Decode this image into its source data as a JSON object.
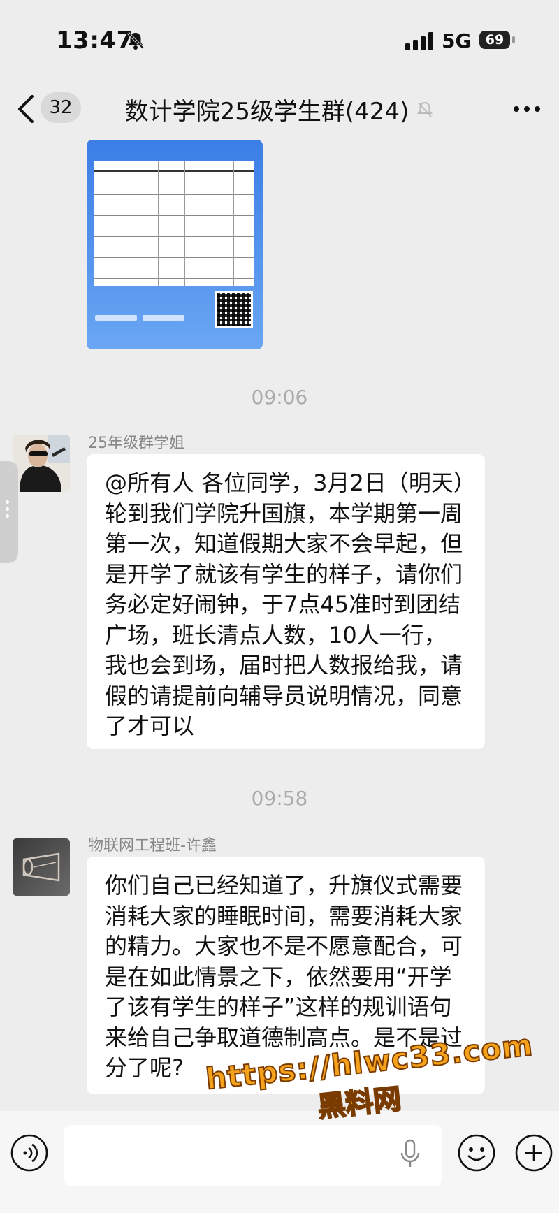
{
  "status_bar": {
    "time": "13:47",
    "network": "5G",
    "battery": "69"
  },
  "nav": {
    "unread_count": "32",
    "title": "数计学院25级学生群(424)"
  },
  "timestamps": [
    "09:06",
    "09:58"
  ],
  "messages": [
    {
      "sender": "25年级群学姐",
      "text": "@所有人 各位同学，3月2日（明天）轮到我们学院升国旗，本学期第一周第一次，知道假期大家不会早起，但是开学了就该有学生的样子，请你们务必定好闹钟，于7点45准时到团结广场，班长清点人数，10人一行，我也会到场，届时把人数报给我，请假的请提前向辅导员说明情况，同意了才可以"
    },
    {
      "sender": "物联网工程班-许鑫",
      "text": "你们自己已经知道了，升旗仪式需要消耗大家的睡眠时间，需要消耗大家的精力。大家也不是不愿意配合，可是在如此情景之下，依然要用“开学了该有学生的样子”这样的规训语句来给自己争取道德制高点。是不是过分了呢?"
    }
  ],
  "watermark": {
    "url": "https://hlwc33.com",
    "label": "黑料网"
  },
  "colors": {
    "background": "#ededed",
    "bubble": "#ffffff",
    "timestamp": "#aaaaaa",
    "watermark": "#f4a21c"
  }
}
